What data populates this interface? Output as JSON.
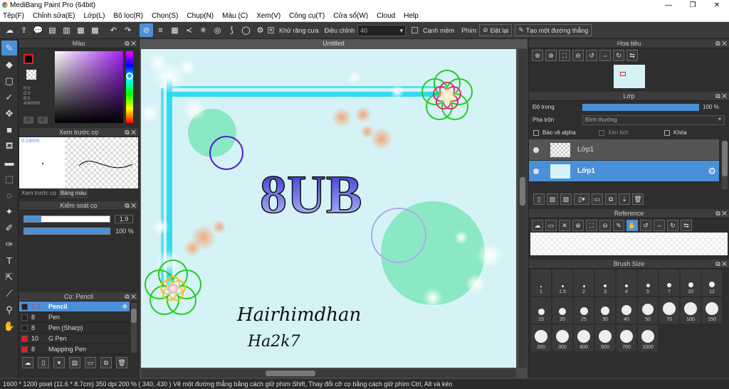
{
  "window": {
    "title": "MediBang Paint Pro (64bit)",
    "min": "—",
    "max": "❐",
    "close": "✕"
  },
  "menu": [
    "Tệp(F)",
    "Chỉnh sửa(E)",
    "Lớp(L)",
    "Bộ lọc(R)",
    "Chọn(S)",
    "Chụp(N)",
    "Màu (C)",
    "Xem(V)",
    "Công cụ(T)",
    "Cửa sổ(W)",
    "Cloud",
    "Help"
  ],
  "toolbar": {
    "antialias_label": "Khử răng cưa",
    "adjust_label": "Điều chỉnh",
    "adjust_value": "40",
    "smooth_label": "Cạnh mềm",
    "key_label": "Phím",
    "set_label": "Đặt lại",
    "line_label": "Tạo một đường thẳng"
  },
  "color_panel": {
    "title": "Màu",
    "r": "R:0",
    "g": "G:0",
    "b": "B:0",
    "hex": "#000000",
    "fg": "#000000",
    "bg": "#ffffff"
  },
  "preview_panel": {
    "title": "Xem trước cọ",
    "size": "0.14mm",
    "tab1": "Xem trước cọ",
    "tab2": "Bảng màu"
  },
  "brush_control": {
    "title": "Kiểm soát cọ",
    "size": "1.9",
    "opacity": "100 %",
    "size_fraction": 0.2,
    "opacity_fraction": 1.0
  },
  "brush_panel": {
    "title": "Cọ: Pencil",
    "items": [
      {
        "size": "1.9",
        "name": "Pencil",
        "color": "#222222"
      },
      {
        "size": "8",
        "name": "Pen",
        "color": "#222222"
      },
      {
        "size": "8",
        "name": "Pen (Sharp)",
        "color": "#222222"
      },
      {
        "size": "10",
        "name": "G Pen",
        "color": "#e02020"
      },
      {
        "size": "8",
        "name": "Mapping Pen",
        "color": "#e02020"
      }
    ]
  },
  "canvas": {
    "tab": "Untitled",
    "text1": "8UB",
    "text2": "Hairhimdhan",
    "text3": "Ha2k7"
  },
  "navigator": {
    "title": "Hoa tiêu"
  },
  "layer_panel": {
    "title": "Lớp",
    "opacity_label": "Độ trong",
    "opacity_value": "100 %",
    "blend_label": "Pha trộn",
    "blend_value": "Bình thường",
    "protect_alpha": "Bảo vệ alpha",
    "clip": "Xén bớt",
    "lock": "Khóa",
    "layers": [
      {
        "name": "Lớp1",
        "selected": false
      },
      {
        "name": "Lớp1",
        "selected": true
      }
    ]
  },
  "reference": {
    "title": "Reference"
  },
  "brush_size": {
    "title": "Brush Size",
    "sizes": [
      "1",
      "1.5",
      "2",
      "3",
      "4",
      "5",
      "7",
      "10",
      "12",
      "15",
      "20",
      "25",
      "30",
      "40",
      "50",
      "70",
      "100",
      "150",
      "200",
      "300",
      "400",
      "500",
      "700",
      "1000"
    ]
  },
  "status": {
    "text": "1600 * 1200 pixel   (11.6 * 8.7cm)   350 dpi   200 %   ( 340, 430 )   Vẽ một đường thẳng bằng cách giữ phím Shift, Thay đổi cỡ cọ bằng cách giữ phím Ctrl, Alt và kéo"
  }
}
